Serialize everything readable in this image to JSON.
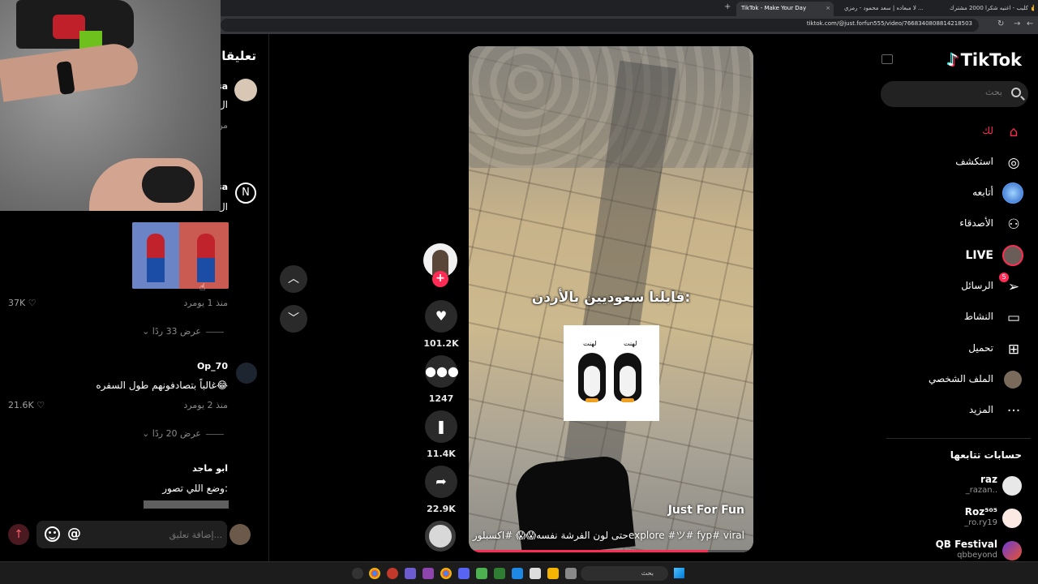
{
  "browser": {
    "tabs": [
      {
        "label": "كليب - اغنيه شكرا 2000 مشترك ✌️",
        "active": false
      },
      {
        "label": "لا مبعاده | سعد محمود - رمزي ...",
        "active": false
      },
      {
        "label": "TikTok - Make Your Day",
        "active": true
      }
    ],
    "url": "tiktok.com/@just.forfun555/video/7668340808814218503"
  },
  "comments": {
    "title": "تعليقات",
    "items": [
      {
        "name_partial": "sa",
        "text_partial": "ال",
        "meta_partial": "من"
      },
      {
        "name_partial": "sa",
        "text_partial": "ال"
      },
      {
        "time": "منذ 1 يوم",
        "reply": "رد",
        "likes": "37K",
        "view_replies": "عرض 33 ردًا"
      },
      {
        "name": "Op_70",
        "text": "غالباً بتصادفونهم طول السفره😂",
        "time": "منذ 2 يوم",
        "reply": "رد",
        "likes": "21.6K",
        "view_replies": "عرض 20 ردًا"
      },
      {
        "name": "ابو ماجد",
        "text": "وضع اللي تصور:"
      }
    ],
    "input_placeholder": "إضافة تعليق...",
    "mention_symbol": "@"
  },
  "video": {
    "caption_overlay": "قابلنا سعوديين بالأردن:",
    "penguin_label": "لهنت",
    "author": "Just For Fun",
    "description": "حتى لون الفرشة نفسه😱😱 #اكسبلورexplore #ツ# fyp# viral",
    "progress": 0.84
  },
  "actions": {
    "likes": "101.2K",
    "comments": "1247",
    "saves": "11.4K",
    "shares": "22.9K"
  },
  "sidebar": {
    "logo": "TikTok",
    "search_placeholder": "بحث",
    "nav": [
      {
        "label": "لك",
        "icon": "home-icon",
        "active": true
      },
      {
        "label": "استكشف",
        "icon": "compass-icon"
      },
      {
        "label": "أتابعه",
        "icon": "following-avatar-icon"
      },
      {
        "label": "الأصدقاء",
        "icon": "friends-icon"
      },
      {
        "label": "LIVE",
        "icon": "live-avatar-icon"
      },
      {
        "label": "الرسائل",
        "icon": "send-icon",
        "badge": "5"
      },
      {
        "label": "النشاط",
        "icon": "activity-icon"
      },
      {
        "label": "تحميل",
        "icon": "upload-icon"
      },
      {
        "label": "الملف الشخصي",
        "icon": "profile-avatar-icon"
      },
      {
        "label": "المزيد",
        "icon": "more-icon"
      }
    ],
    "following_title": "حسابات تتابعها",
    "accounts": [
      {
        "name": "raz",
        "handle": "_razan.."
      },
      {
        "name": "Roz⁵⁰⁵",
        "handle": "_ro.ry19"
      },
      {
        "name": "QB Festival",
        "handle": "qbbeyond"
      }
    ]
  },
  "taskbar": {
    "search_label": "بحث"
  },
  "colors": {
    "accent": "#fe2c55",
    "background": "#000000"
  }
}
